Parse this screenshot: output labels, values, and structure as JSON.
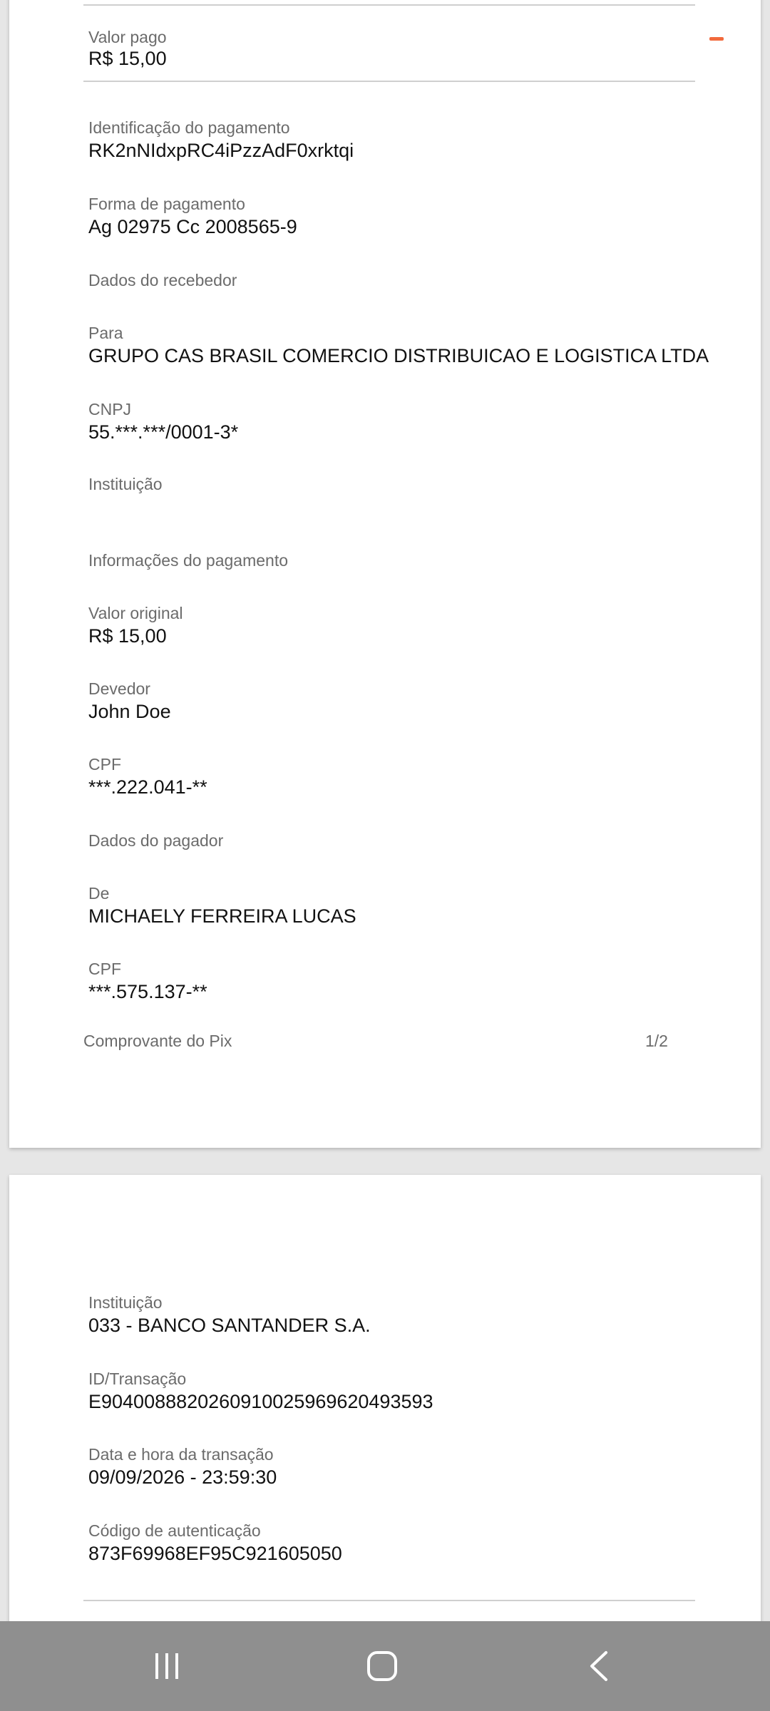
{
  "page1": {
    "paid_label": "Valor pago",
    "paid_value": "R$ 15,00",
    "payment_id_label": "Identificação do pagamento",
    "payment_id_value": "RK2nNIdxpRC4iPzzAdF0xrktqi",
    "method_label": "Forma de pagamento",
    "method_value": "Ag 02975 Cc 2008565-9",
    "receiver_section": "Dados do recebedor",
    "to_label": "Para",
    "to_value": "GRUPO CAS BRASIL COMERCIO DISTRIBUICAO E LOGISTICA LTDA",
    "cnpj_label": "CNPJ",
    "cnpj_value": "55.***.***/0001-3*",
    "institution_label": "Instituição",
    "payment_info_section": "Informações do pagamento",
    "original_label": "Valor original",
    "original_value": "R$ 15,00",
    "debtor_label": "Devedor",
    "debtor_value": "John Doe",
    "debtor_cpf_label": "CPF",
    "debtor_cpf_value": "***.222.041-**",
    "payer_section": "Dados do pagador",
    "from_label": "De",
    "from_value": "MICHAELY FERREIRA LUCAS",
    "payer_cpf_label": "CPF",
    "payer_cpf_value": "***.575.137-**",
    "footer_title": "Comprovante do Pix",
    "footer_page": "1/2"
  },
  "page2": {
    "institution_label": "Instituição",
    "institution_value": "033 - BANCO SANTANDER S.A.",
    "txid_label": "ID/Transação",
    "txid_value": "E90400888202609100259696204935​93",
    "datetime_label": "Data e hora da transação",
    "datetime_value": "09/09/2026 - 23:59:30",
    "auth_label": "Código de autenticação",
    "auth_value": "873F69968EF95C921605050"
  },
  "navbar": {
    "recents_icon": "recents-icon",
    "home_icon": "home-icon",
    "back_icon": "back-icon"
  },
  "colors": {
    "accent": "#f26a3d",
    "navbar": "#8f8f8f"
  }
}
